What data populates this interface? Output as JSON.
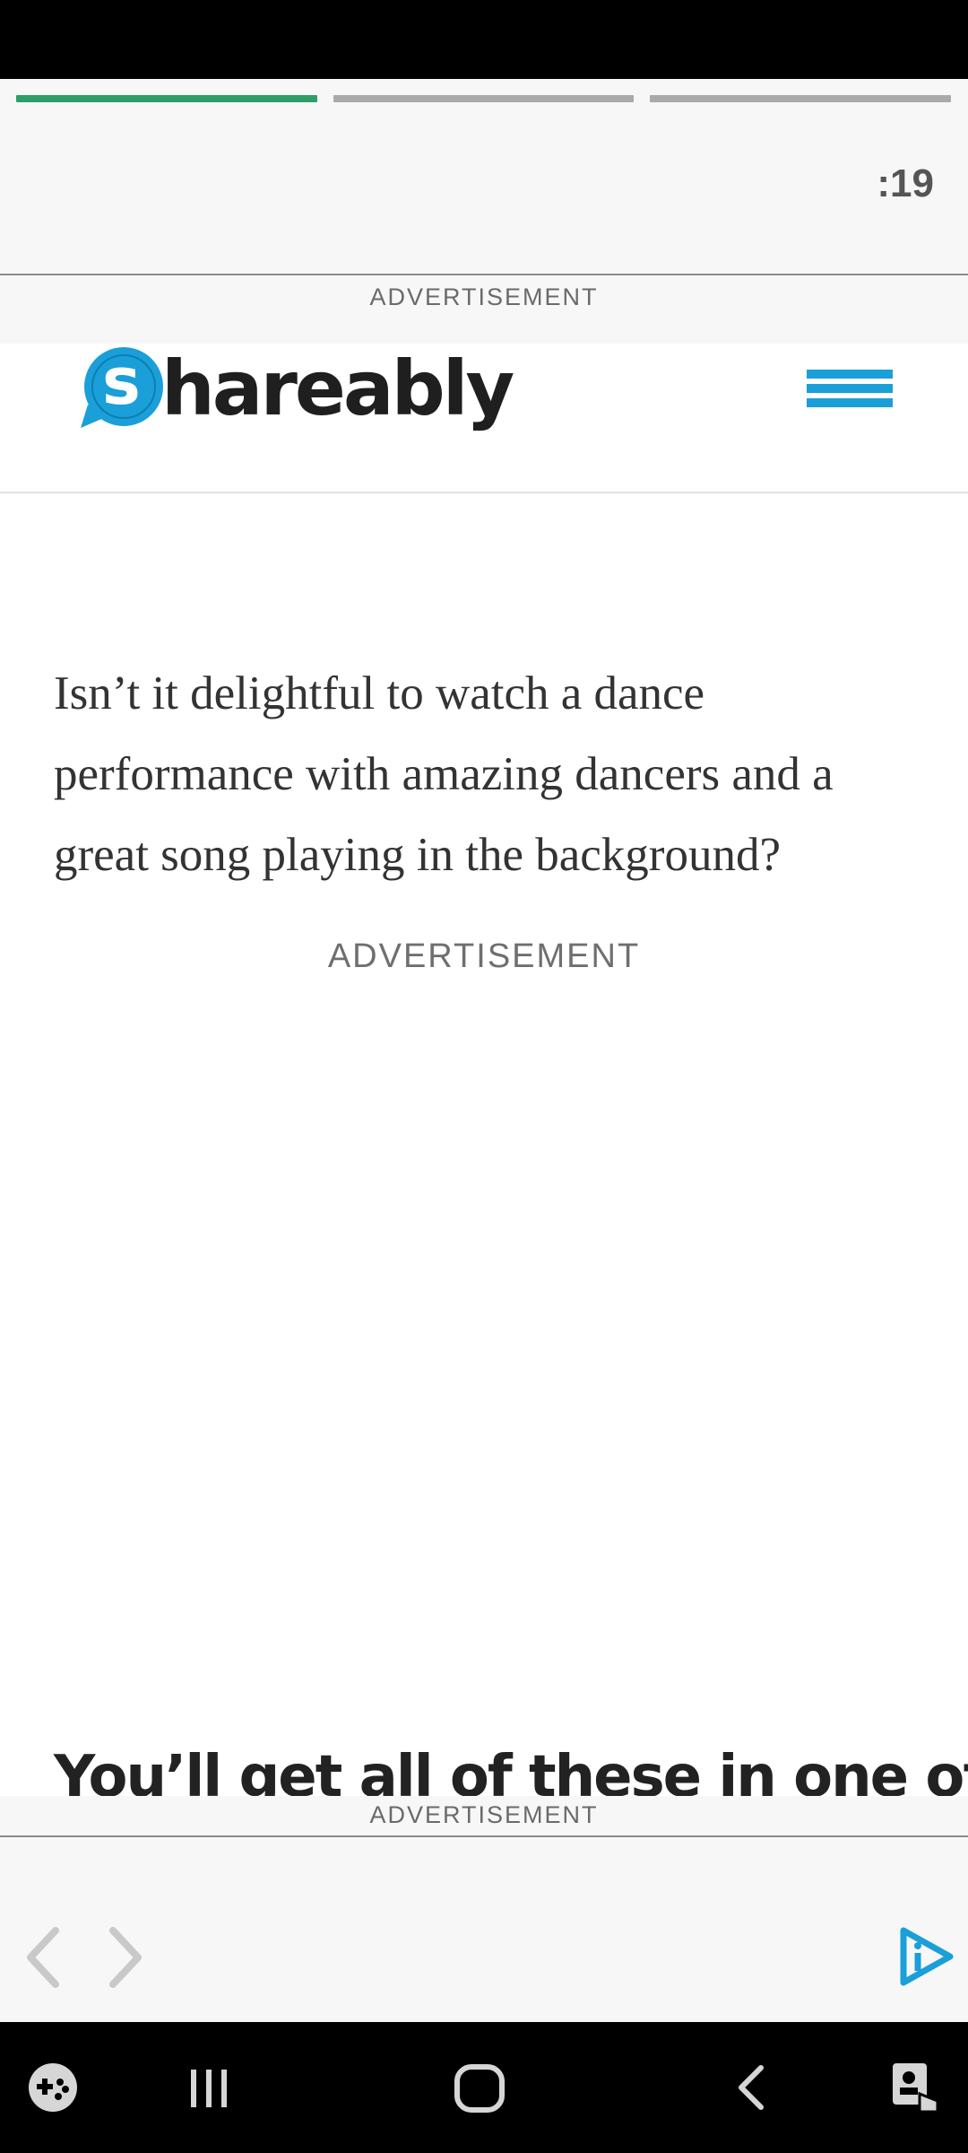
{
  "top_ad": {
    "timer": ":19",
    "progress_segments": [
      1,
      0,
      0
    ],
    "label": "ADVERTISEMENT"
  },
  "header": {
    "logo_letter": "s",
    "logo_rest": "hareably",
    "accent_color": "#1a9fd8"
  },
  "article": {
    "paragraph": "Isn’t it delightful to watch a dance performance with amazing dancers and a great song playing in the background?",
    "ad_label": "ADVERTISEMENT",
    "headline": "You’ll get all of these in one of"
  },
  "bottom_ad": {
    "label": "ADVERTISEMENT"
  },
  "nav": {
    "items": [
      "game-launcher-icon",
      "recents-icon",
      "home-icon",
      "back-icon",
      "accessibility-icon"
    ]
  }
}
